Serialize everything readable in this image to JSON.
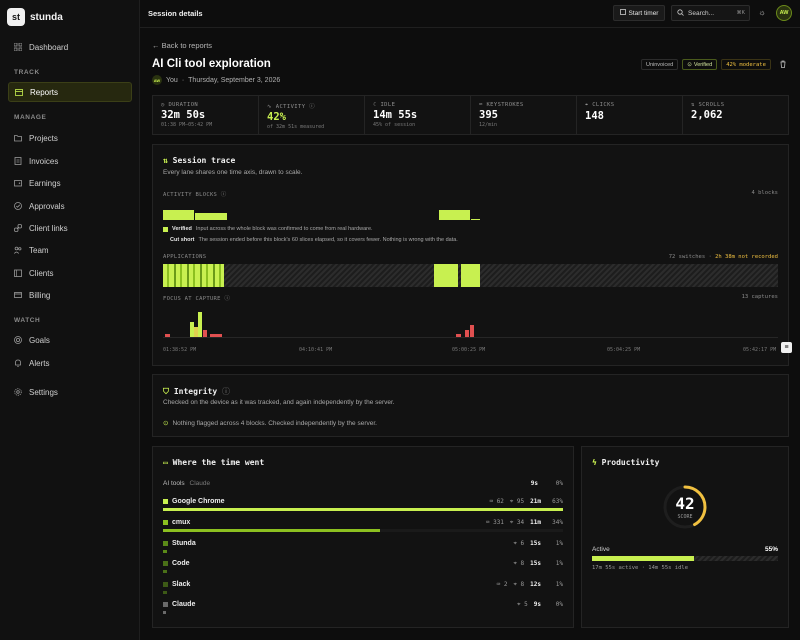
{
  "brand": {
    "logo": "st",
    "name": "stunda"
  },
  "sidebar": {
    "sections": {
      "track": "TRACK",
      "manage": "MANAGE",
      "watch": "WATCH"
    },
    "items": [
      {
        "label": "Dashboard",
        "icon": "grid-icon"
      },
      {
        "label": "Reports",
        "icon": "calendar-icon"
      },
      {
        "label": "Projects",
        "icon": "folder-icon"
      },
      {
        "label": "Invoices",
        "icon": "invoice-icon"
      },
      {
        "label": "Earnings",
        "icon": "wallet-icon"
      },
      {
        "label": "Approvals",
        "icon": "check-circle-icon"
      },
      {
        "label": "Client links",
        "icon": "link-icon"
      },
      {
        "label": "Team",
        "icon": "team-icon"
      },
      {
        "label": "Clients",
        "icon": "clients-icon"
      },
      {
        "label": "Billing",
        "icon": "card-icon"
      },
      {
        "label": "Goals",
        "icon": "target-icon"
      },
      {
        "label": "Alerts",
        "icon": "bell-icon"
      },
      {
        "label": "Settings",
        "icon": "gear-icon"
      }
    ]
  },
  "topbar": {
    "title": "Session details",
    "start_timer": "Start timer",
    "search_placeholder": "Search...",
    "search_kbd": "⌘K",
    "avatar": "AW"
  },
  "header": {
    "back": "Back to reports",
    "title": "AI Cli tool exploration",
    "avatar": "AW",
    "user": "You",
    "date": "Thursday, September 3, 2026",
    "badges": {
      "uninvoiced": "Uninvoiced",
      "verified": "Verified",
      "moderate": "42% moderate"
    }
  },
  "stats": [
    {
      "label": "DURATION",
      "value": "32m 50s",
      "sub": "01:38 PM–05:42 PM",
      "accent": false
    },
    {
      "label": "ACTIVITY",
      "value": "42%",
      "sub": "of 32m 51s measured",
      "accent": true
    },
    {
      "label": "IDLE",
      "value": "14m 55s",
      "sub": "45% of session",
      "accent": false
    },
    {
      "label": "KEYSTROKES",
      "value": "395",
      "sub": "12/min",
      "accent": false
    },
    {
      "label": "CLICKS",
      "value": "148",
      "sub": "",
      "accent": false
    },
    {
      "label": "SCROLLS",
      "value": "2,062",
      "sub": "",
      "accent": false
    }
  ],
  "trace": {
    "title": "Session trace",
    "subtitle": "Every lane shares one time axis, drawn to scale.",
    "activity_label": "ACTIVITY BLOCKS",
    "activity_count": "4 blocks",
    "legend_verified_title": "Verified",
    "legend_verified_text": "Input across the whole block was confirmed to come from real hardware.",
    "legend_cut_title": "Cut short",
    "legend_cut_text": "The session ended before this block's 60 slices elapsed, so it covers fewer. Nothing is wrong with the data.",
    "apps_label": "APPLICATIONS",
    "apps_switches": "72 switches",
    "apps_not_recorded": "2h 38m not recorded",
    "focus_label": "FOCUS AT CAPTURE",
    "focus_count": "13 captures",
    "ticks": [
      "01:38:52 PM",
      "04:10:41 PM",
      "05:00:25 PM",
      "05:04:25 PM",
      "05:42:17 PM"
    ]
  },
  "integrity": {
    "title": "Integrity",
    "subtitle": "Checked on the device as it was tracked, and again independently by the server.",
    "status": "Nothing flagged across 4 blocks. Checked independently by the server."
  },
  "where": {
    "title": "Where the time went",
    "group_label": "AI tools",
    "group_sub": "Claude",
    "group_time": "9s",
    "group_pct": "0%",
    "rows": [
      {
        "name": "Google Chrome",
        "stats": [
          "62",
          "95"
        ],
        "dur": "21m",
        "pct": "63%",
        "frac": 1.0,
        "color": "#c8f050"
      },
      {
        "name": "cmux",
        "stats": [
          "331",
          "34"
        ],
        "dur": "11m",
        "pct": "34%",
        "frac": 0.54,
        "color": "#8cc020"
      },
      {
        "name": "Stunda",
        "stats": [
          "",
          "6"
        ],
        "dur": "15s",
        "pct": "1%",
        "frac": 0.012,
        "color": "#5a8a18"
      },
      {
        "name": "Code",
        "stats": [
          "",
          "8"
        ],
        "dur": "15s",
        "pct": "1%",
        "frac": 0.012,
        "color": "#4a7018"
      },
      {
        "name": "Slack",
        "stats": [
          "2",
          "8"
        ],
        "dur": "12s",
        "pct": "1%",
        "frac": 0.01,
        "color": "#3d5a16"
      },
      {
        "name": "Claude",
        "stats": [
          "",
          "5"
        ],
        "dur": "9s",
        "pct": "0%",
        "frac": 0.008,
        "color": "#6a6a6a"
      }
    ]
  },
  "productivity": {
    "title": "Productivity",
    "score": "42",
    "score_label": "SCORE",
    "score_value": 0.42,
    "active_label": "Active",
    "active_pct": "55%",
    "active_frac": 0.55,
    "footer": "17m 55s active · 14m 55s idle"
  },
  "colors": {
    "accent": "#c8f050",
    "warn": "#f0c040",
    "bad": "#e05050"
  }
}
